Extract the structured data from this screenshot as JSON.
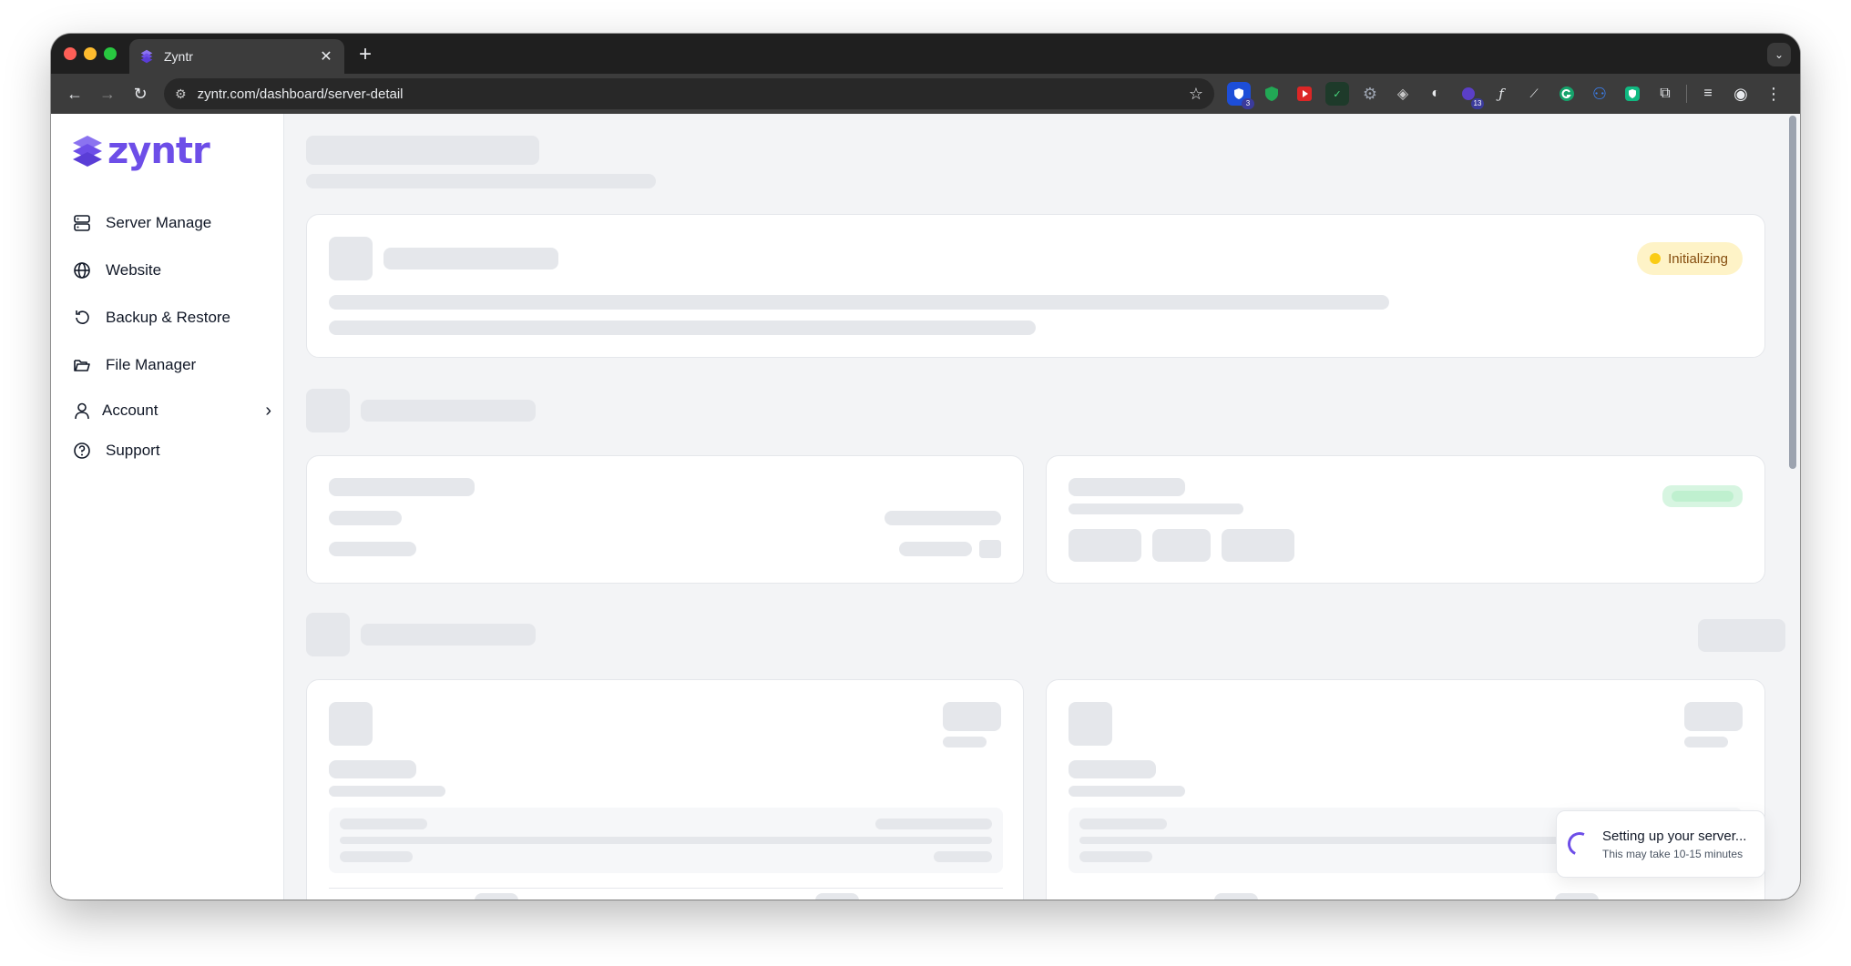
{
  "browser": {
    "tab_title": "Zyntr",
    "new_tab_icon": "plus-icon",
    "url": "zyntr.com/dashboard/server-detail",
    "extension_badges": {
      "first": "3",
      "second": "13"
    }
  },
  "sidebar": {
    "logo_text": "zyntr",
    "items": [
      {
        "label": "Server Manage",
        "icon": "server-icon"
      },
      {
        "label": "Website",
        "icon": "globe-icon"
      },
      {
        "label": "Backup & Restore",
        "icon": "restore-icon"
      },
      {
        "label": "File Manager",
        "icon": "folder-icon"
      },
      {
        "label": "Account",
        "icon": "user-icon"
      },
      {
        "label": "Support",
        "icon": "help-circle-icon"
      }
    ]
  },
  "server_card": {
    "status": "Initializing",
    "status_color": "#facc15"
  },
  "toast": {
    "title": "Setting up your server...",
    "subtitle": "This may take 10-15 minutes"
  },
  "colors": {
    "brand": "#6d4ee8",
    "skeleton": "#e5e7eb",
    "page_bg": "#f3f4f6"
  }
}
